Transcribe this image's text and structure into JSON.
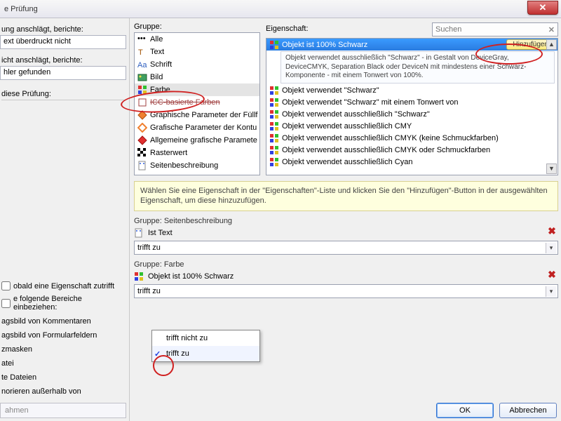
{
  "window": {
    "title": "e Prüfung"
  },
  "left": {
    "label1": "ung anschlägt, berichte:",
    "value1": "ext überdruckt nicht",
    "label2": "icht anschlägt, berichte:",
    "value2": "hler gefunden",
    "section": "diese Prüfung:",
    "check1": "obald eine Eigenschaft zutrifft",
    "check2": "e folgende Bereiche einbeziehen:",
    "items": [
      "agsbild von Kommentaren",
      "agsbild von Formularfeldern",
      "zmasken",
      "atei",
      "te Dateien",
      "norieren außerhalb von"
    ],
    "footerBtn": "ahmen"
  },
  "group": {
    "label": "Gruppe:",
    "items": [
      {
        "t": "Alle"
      },
      {
        "t": "Text"
      },
      {
        "t": "Schrift"
      },
      {
        "t": "Bild"
      },
      {
        "t": "Farbe",
        "sel": true
      },
      {
        "t": "ICC-basierte Farben",
        "strike": true
      },
      {
        "t": "Graphische Parameter der Füllf"
      },
      {
        "t": "Grafische Parameter der Kontu"
      },
      {
        "t": "Allgemeine grafische Paramete"
      },
      {
        "t": "Rasterwert"
      },
      {
        "t": "Seitenbeschreibung"
      }
    ]
  },
  "prop": {
    "label": "Eigenschaft:",
    "search_placeholder": "Suchen",
    "add_label": "Hinzufügen",
    "selected": "Objekt ist 100% Schwarz",
    "desc": "Objekt verwendet ausschließlich \"Schwarz\" - in Gestalt von DeviceGray, DeviceCMYK, Separation Black oder DeviceN mit mindestens einer Schwarz-Komponente - mit einem Tonwert von 100%.",
    "rows": [
      "Objekt verwendet \"Schwarz\"",
      "Objekt verwendet \"Schwarz\" mit einem Tonwert von",
      "Objekt verwendet ausschließlich \"Schwarz\"",
      "Objekt verwendet ausschließlich CMY",
      "Objekt verwendet ausschließlich CMYK (keine Schmuckfarben)",
      "Objekt verwendet ausschließlich CMYK oder Schmuckfarben",
      "Objekt verwendet ausschließlich Cyan"
    ]
  },
  "hint": "Wählen Sie eine Eigenschaft in der \"Eigenschaften\"-Liste und klicken Sie den \"Hinzufügen\"-Button in der ausgewählten Eigenschaft, um diese hinzuzufügen.",
  "crit1": {
    "group_label": "Gruppe:",
    "group_val": "Seitenbeschreibung",
    "prop": "Ist Text",
    "combo": "trifft zu"
  },
  "crit2": {
    "group_label": "Gruppe:",
    "group_val": "Farbe",
    "prop": "Objekt ist 100% Schwarz",
    "combo": "trifft zu"
  },
  "dropdown": {
    "opt1": "trifft nicht zu",
    "opt2": "trifft zu"
  },
  "buttons": {
    "ok": "OK",
    "cancel": "Abbrechen"
  }
}
